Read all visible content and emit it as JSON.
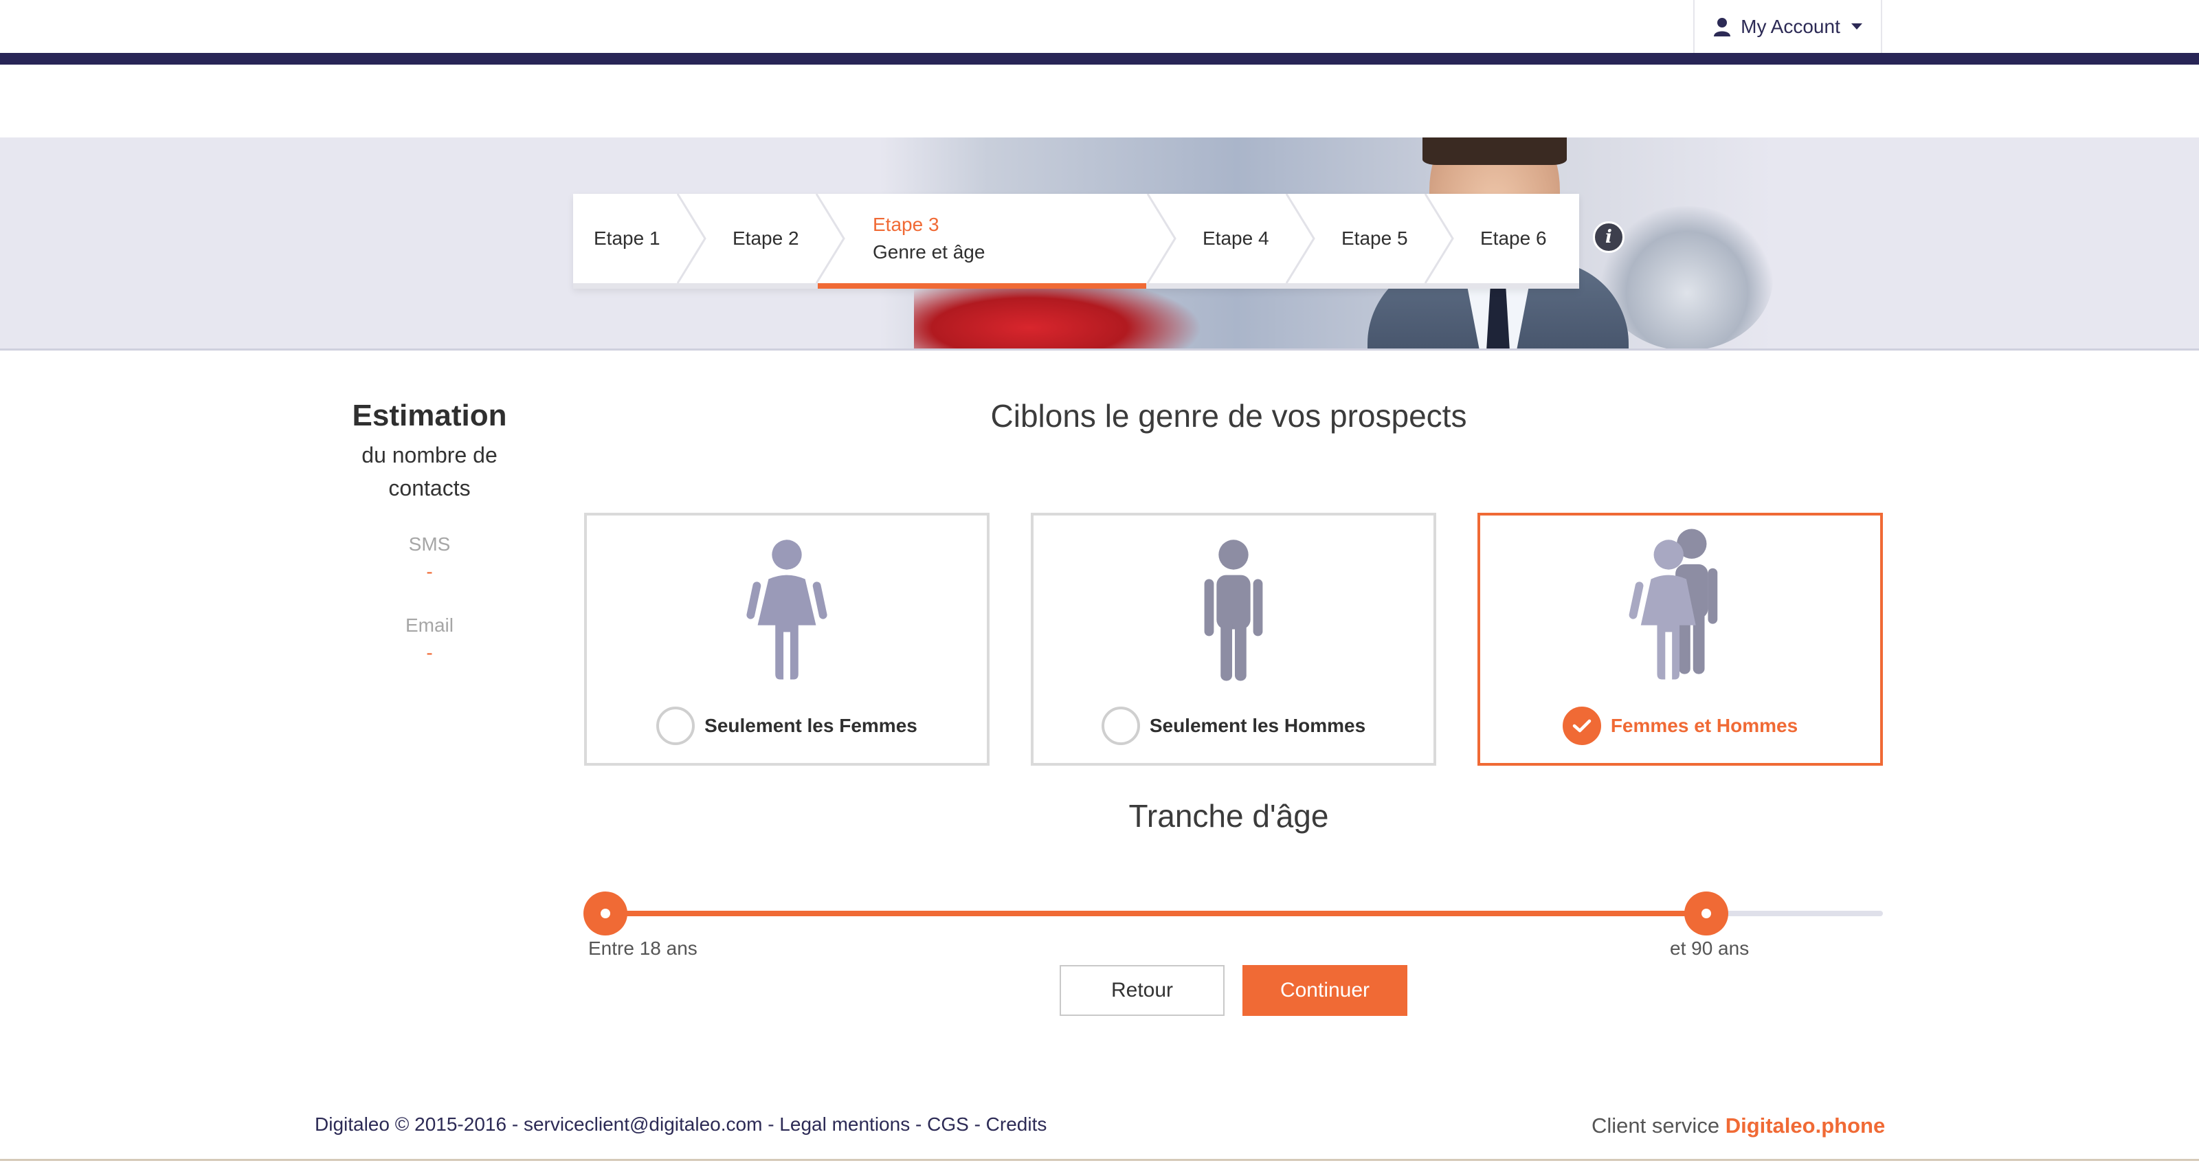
{
  "header": {
    "account_label": "My Account",
    "account_icon": "user-icon"
  },
  "stepper": {
    "steps": [
      {
        "label": "Etape 1"
      },
      {
        "label": "Etape 2"
      },
      {
        "label": "Etape 3",
        "subtitle": "Genre et âge",
        "active": true
      },
      {
        "label": "Etape 4"
      },
      {
        "label": "Etape 5"
      },
      {
        "label": "Etape 6"
      }
    ],
    "info_icon": "info-icon",
    "info_glyph": "i"
  },
  "estimation": {
    "title": "Estimation",
    "subtitle": "du nombre de contacts",
    "sms_label": "SMS",
    "sms_value": "-",
    "email_label": "Email",
    "email_value": "-"
  },
  "gender": {
    "title": "Ciblons le genre de vos prospects",
    "options": [
      {
        "label": "Seulement les Femmes",
        "icon": "woman-icon",
        "selected": false
      },
      {
        "label": "Seulement les Hommes",
        "icon": "man-icon",
        "selected": false
      },
      {
        "label": "Femmes et Hommes",
        "icon": "couple-icon",
        "selected": true
      }
    ]
  },
  "age": {
    "title": "Tranche d'âge",
    "min_label": "Entre 18 ans",
    "max_label": "et 90 ans",
    "min_value": 18,
    "max_value": 90
  },
  "actions": {
    "back_label": "Retour",
    "continue_label": "Continuer"
  },
  "footer": {
    "copyright": "Digitaleo © 2015-2016",
    "email": "serviceclient@digitaleo.com",
    "legal": "Legal mentions",
    "cgs": "CGS",
    "credits": "Credits",
    "service_label": "Client service",
    "service_brand": "Digitaleo.phone"
  },
  "colors": {
    "accent": "#f06a35",
    "navy": "#282556",
    "figure": "#9a9ab8"
  }
}
